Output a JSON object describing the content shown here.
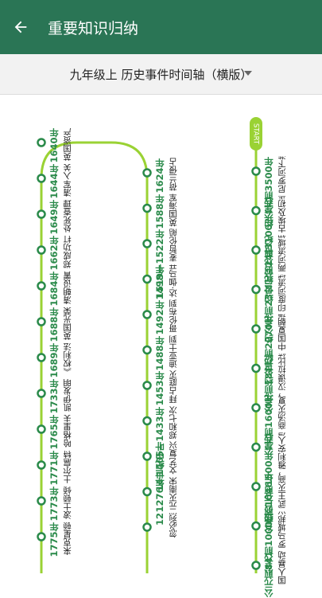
{
  "app": {
    "title": "重要知识归纳"
  },
  "selector": {
    "value": "九年级上 历史事件时间轴（横版）"
  },
  "timeline": {
    "start_badge": "START",
    "line_color": "#9ad234",
    "year_color": "#2a8a4a",
    "columns": [
      {
        "events": [
          {
            "year": "约公元前3500年",
            "text": "尼罗河下游出现小国；两河流域出现城邦国家"
          },
          {
            "year": "公元前3100年左右",
            "text": "古埃及初步统一"
          },
          {
            "year": "约公元前24世纪",
            "text": "两河流域初步统一"
          },
          {
            "year": "约公元前23世纪",
            "text": "印度河流域出现早期文明"
          },
          {
            "year": "约公元前2070年",
            "text": "中国夏朝建立"
          },
          {
            "year": "公元前18世纪",
            "text": "汉谟拉比统一两河流域中下游地区"
          },
          {
            "year": "公元前1600年",
            "text": "商汤灭夏，商朝建立"
          },
          {
            "year": "约公元前1500年左右",
            "text": "雅利安人侵入印度"
          },
          {
            "year": "公元前1046年",
            "text": "武王灭商，西周开始"
          },
          {
            "year": "公元前1000年",
            "text": "罗马城邦兴起；周王朝"
          },
          {
            "year": "公元前841",
            "text": "国人暴动"
          }
        ]
      },
      {
        "events": [
          {
            "year": "1624年",
            "text": "荷兰侵占我国台湾"
          },
          {
            "year": "1588年",
            "text": "英国海军打败西班牙“无敌舰队”"
          },
          {
            "year": "1519—1522年",
            "text": "麦哲伦船队环球航行"
          },
          {
            "year": "1498年",
            "text": "达·伽马开辟到达印度的新航路"
          },
          {
            "year": "1492年",
            "text": "哥伦布到达美洲"
          },
          {
            "year": "1488年",
            "text": "迪亚士到达非洲好望角"
          },
          {
            "year": "1453年",
            "text": "拜占庭灭亡"
          },
          {
            "year": "1405—1433年",
            "text": "郑和七次下西洋"
          },
          {
            "year": "14世纪中叶",
            "text": "文艺复兴开始"
          },
          {
            "year": "1276年",
            "text": "元灭南宋"
          },
          {
            "year": "12",
            "text": "忽必烈"
          }
        ]
      },
      {
        "events": [
          {
            "year": "1640年",
            "text": "英国资产阶级革命爆发"
          },
          {
            "year": "1644年",
            "text": "清军入关"
          },
          {
            "year": "1649年",
            "text": "处死查理一世"
          },
          {
            "year": "1662年",
            "text": "郑成功打败荷兰殖民者，收复台湾"
          },
          {
            "year": "1684年",
            "text": "清朝设置台湾府"
          },
          {
            "year": "1688年",
            "text": "英国光荣革命"
          },
          {
            "year": "1689年",
            "text": "《权利法案》签订；中俄签订《尼布楚条约》"
          },
          {
            "year": "1733年",
            "text": "凯伊发明飞梭"
          },
          {
            "year": "1765年",
            "text": "哈格里夫斯发明“珍妮机”，第一次工业革命开始"
          },
          {
            "year": "1771年",
            "text": "土尔扈特部回归祖国"
          },
          {
            "year": "1773年",
            "text": "波士顿倾茶事件"
          },
          {
            "year": "1775年",
            "text": "来克星顿枪声"
          }
        ]
      }
    ]
  }
}
